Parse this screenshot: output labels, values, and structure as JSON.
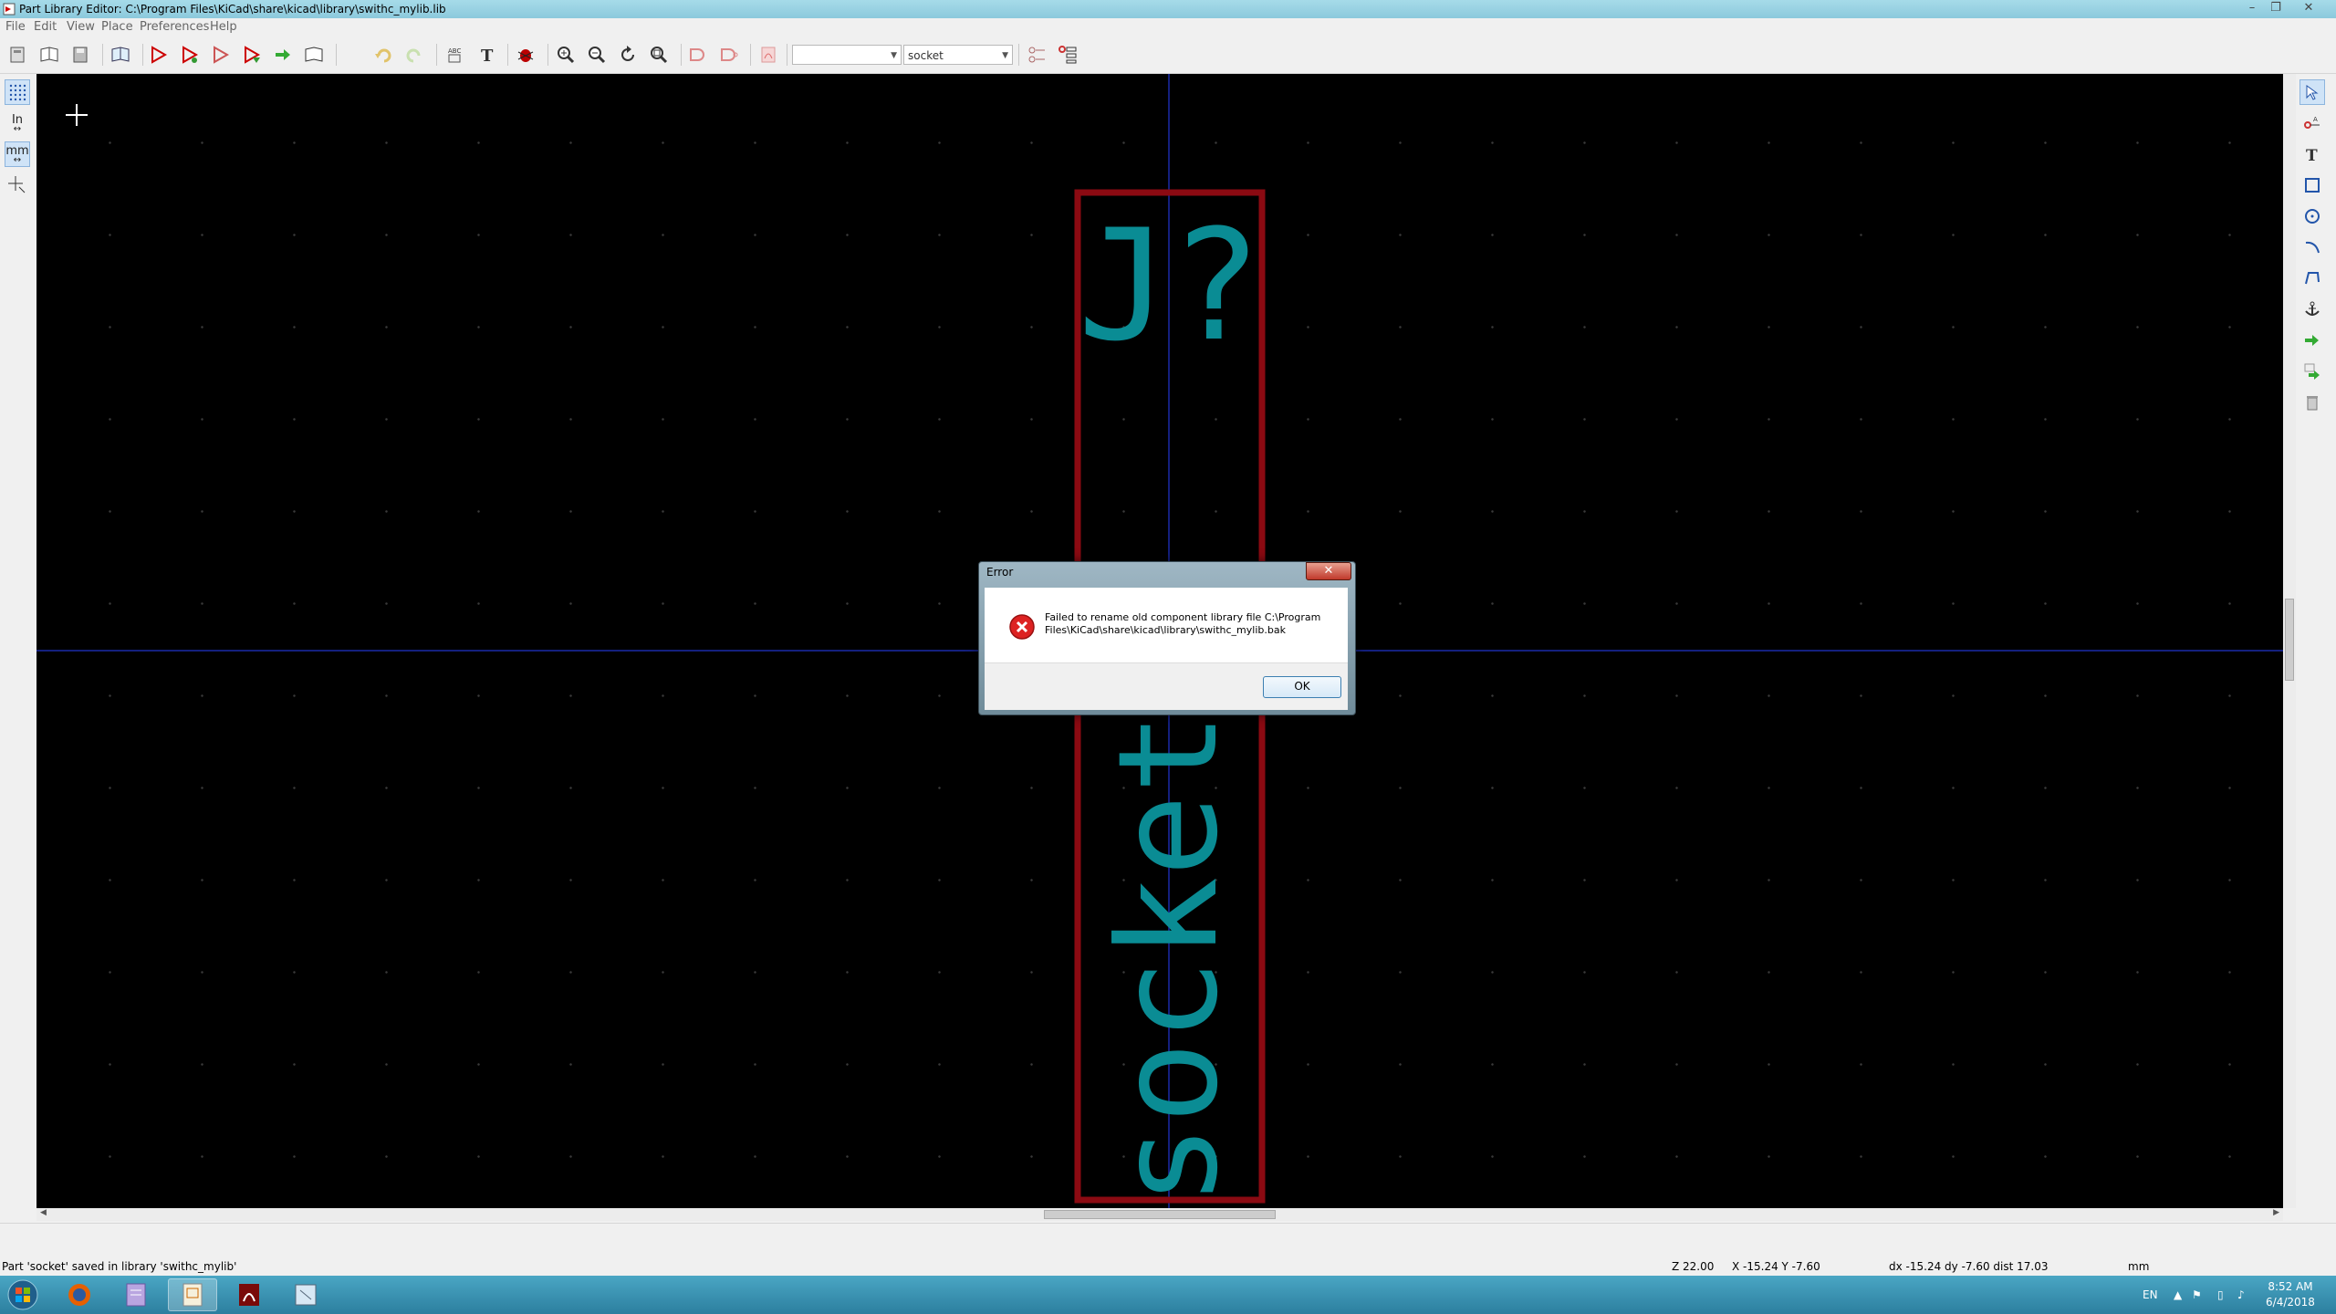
{
  "window": {
    "title": "Part Library Editor: C:\\Program Files\\KiCad\\share\\kicad\\library\\swithc_mylib.lib",
    "controls": [
      "minimize",
      "restore",
      "close"
    ]
  },
  "menu": [
    "File",
    "Edit",
    "View",
    "Place",
    "Preferences",
    "Help"
  ],
  "toolbar": {
    "alias_combo_value": "",
    "part_combo_value": "socket"
  },
  "left_toolbar": {
    "inch_label": "In",
    "mm_label": "mm"
  },
  "canvas": {
    "reference_text": "J?",
    "value_text": "socket",
    "body_outline_color": "#8b0a12",
    "text_color": "#0a8c94",
    "background_color": "#000000",
    "axis_color": "#1a2aa8"
  },
  "dialog": {
    "title": "Error",
    "message_line1": "Failed to rename old component library file C:\\Program",
    "message_line2": "Files\\KiCad\\share\\kicad\\library\\swithc_mylib.bak",
    "ok_label": "OK",
    "icon": "error-icon"
  },
  "status": {
    "message": "Part 'socket' saved in library 'swithc_mylib'",
    "zoom": "Z 22.00",
    "xy": "X -15.24  Y -7.60",
    "delta": "dx -15.24  dy -7.60  dist 17.03",
    "units": "mm"
  },
  "taskbar": {
    "apps": [
      "start-button",
      "firefox",
      "notepad",
      "library-editor",
      "acrobat",
      "kicad"
    ],
    "language": "EN",
    "time": "8:52 AM",
    "date": "6/4/2018"
  }
}
